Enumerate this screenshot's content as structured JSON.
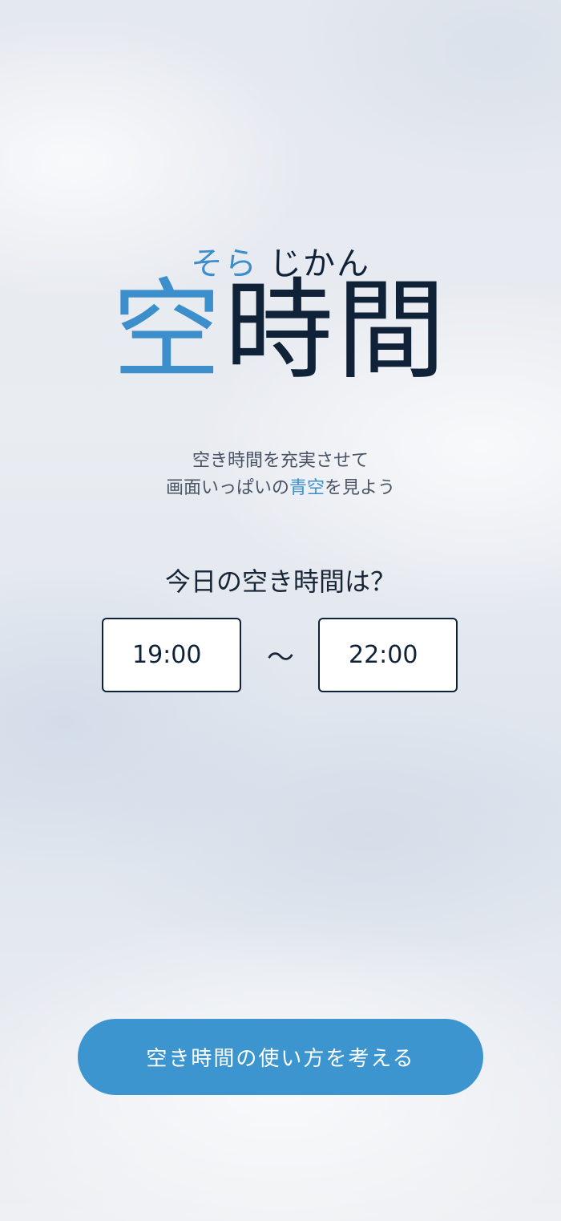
{
  "header": {
    "furigana_blue": "そら",
    "furigana_dark": "じかん",
    "logo_blue": "空",
    "logo_dark": "時間"
  },
  "tagline": {
    "line1": "空き時間を充実させて",
    "line2_prefix": "画面いっぱいの",
    "line2_highlight": "青空",
    "line2_suffix": "を見よう"
  },
  "question": "今日の空き時間は？",
  "time_range": {
    "start": "19:00",
    "separator": "〜",
    "end": "22:00"
  },
  "cta_label": "空き時間の使い方を考える",
  "colors": {
    "accent": "#3d8fcb",
    "text_dark": "#0f2238",
    "button": "#3d95cf"
  }
}
